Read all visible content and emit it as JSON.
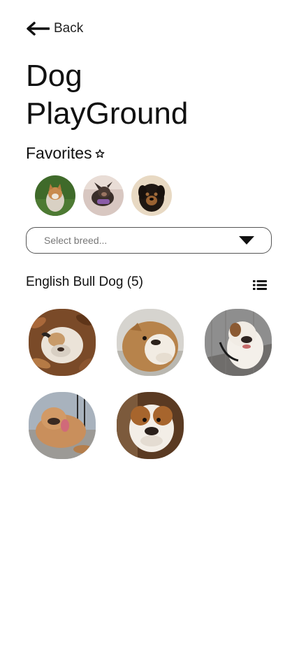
{
  "nav": {
    "back_label": "Back",
    "back_icon": "arrow-left-icon"
  },
  "page": {
    "title_line1": "Dog",
    "title_line2": "PlayGround"
  },
  "favorites": {
    "heading": "Favorites",
    "heading_icon": "star-outline-icon",
    "items": [
      {
        "name": "favorite-dog-1"
      },
      {
        "name": "favorite-dog-2"
      },
      {
        "name": "favorite-dog-3"
      }
    ]
  },
  "breed_select": {
    "placeholder": "Select breed...",
    "icon": "caret-down-icon"
  },
  "results": {
    "heading": "English Bull Dog (5)",
    "view_toggle_icon": "list-view-icon",
    "count": 5
  },
  "colors": {
    "text": "#111111",
    "muted": "#777777",
    "border": "#555555",
    "background": "#ffffff"
  }
}
